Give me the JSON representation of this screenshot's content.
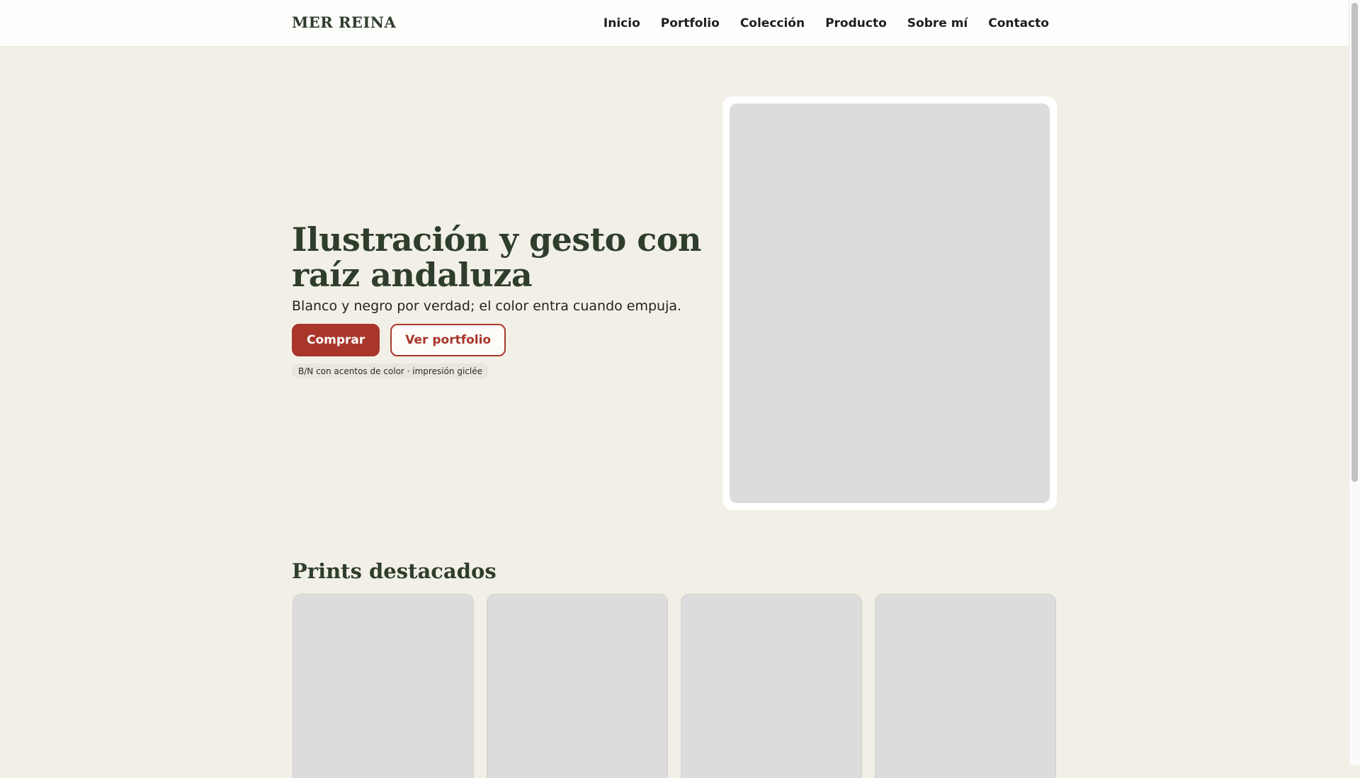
{
  "brand": "MER REINA",
  "nav": [
    "Inicio",
    "Portfolio",
    "Colección",
    "Producto",
    "Sobre mí",
    "Contacto"
  ],
  "hero": {
    "title": "Ilustración y gesto con raíz andaluza",
    "subtitle": "Blanco y negro por verdad; el color entra cuando empuja.",
    "primary_cta": "Comprar",
    "secondary_cta": "Ver portfolio",
    "tag": "B/N con acentos de color · impresión giclée"
  },
  "featured": {
    "title": "Prints destacados",
    "count": 4
  },
  "colors": {
    "background": "#f2f0e6",
    "brand_green": "#2f3d2c",
    "accent_red": "#a8362a",
    "placeholder": "#dcdcdc"
  }
}
